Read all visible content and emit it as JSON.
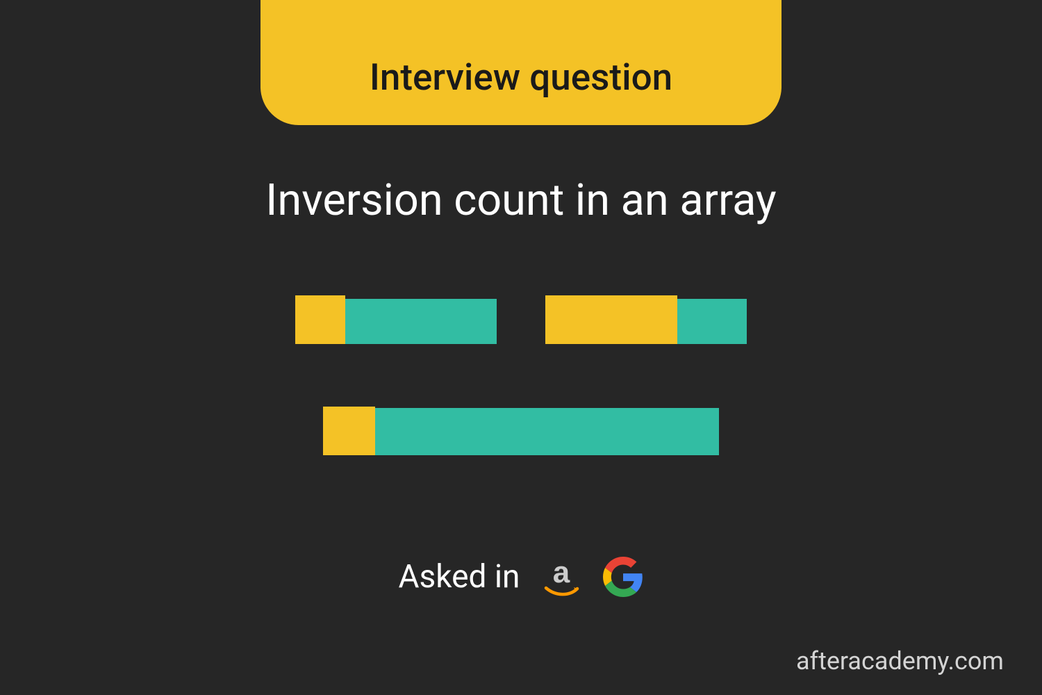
{
  "badge": {
    "label": "Interview question"
  },
  "title": "Inversion count in an array",
  "asked": {
    "label": "Asked in"
  },
  "footer": {
    "text": "afteracademy.com"
  },
  "icons": {
    "amazon": "amazon-icon",
    "google": "google-icon"
  },
  "colors": {
    "background": "#262626",
    "accent_yellow": "#F4C226",
    "accent_teal": "#32BDA3",
    "text_light": "#ffffff",
    "text_dark": "#1a1a1a"
  }
}
